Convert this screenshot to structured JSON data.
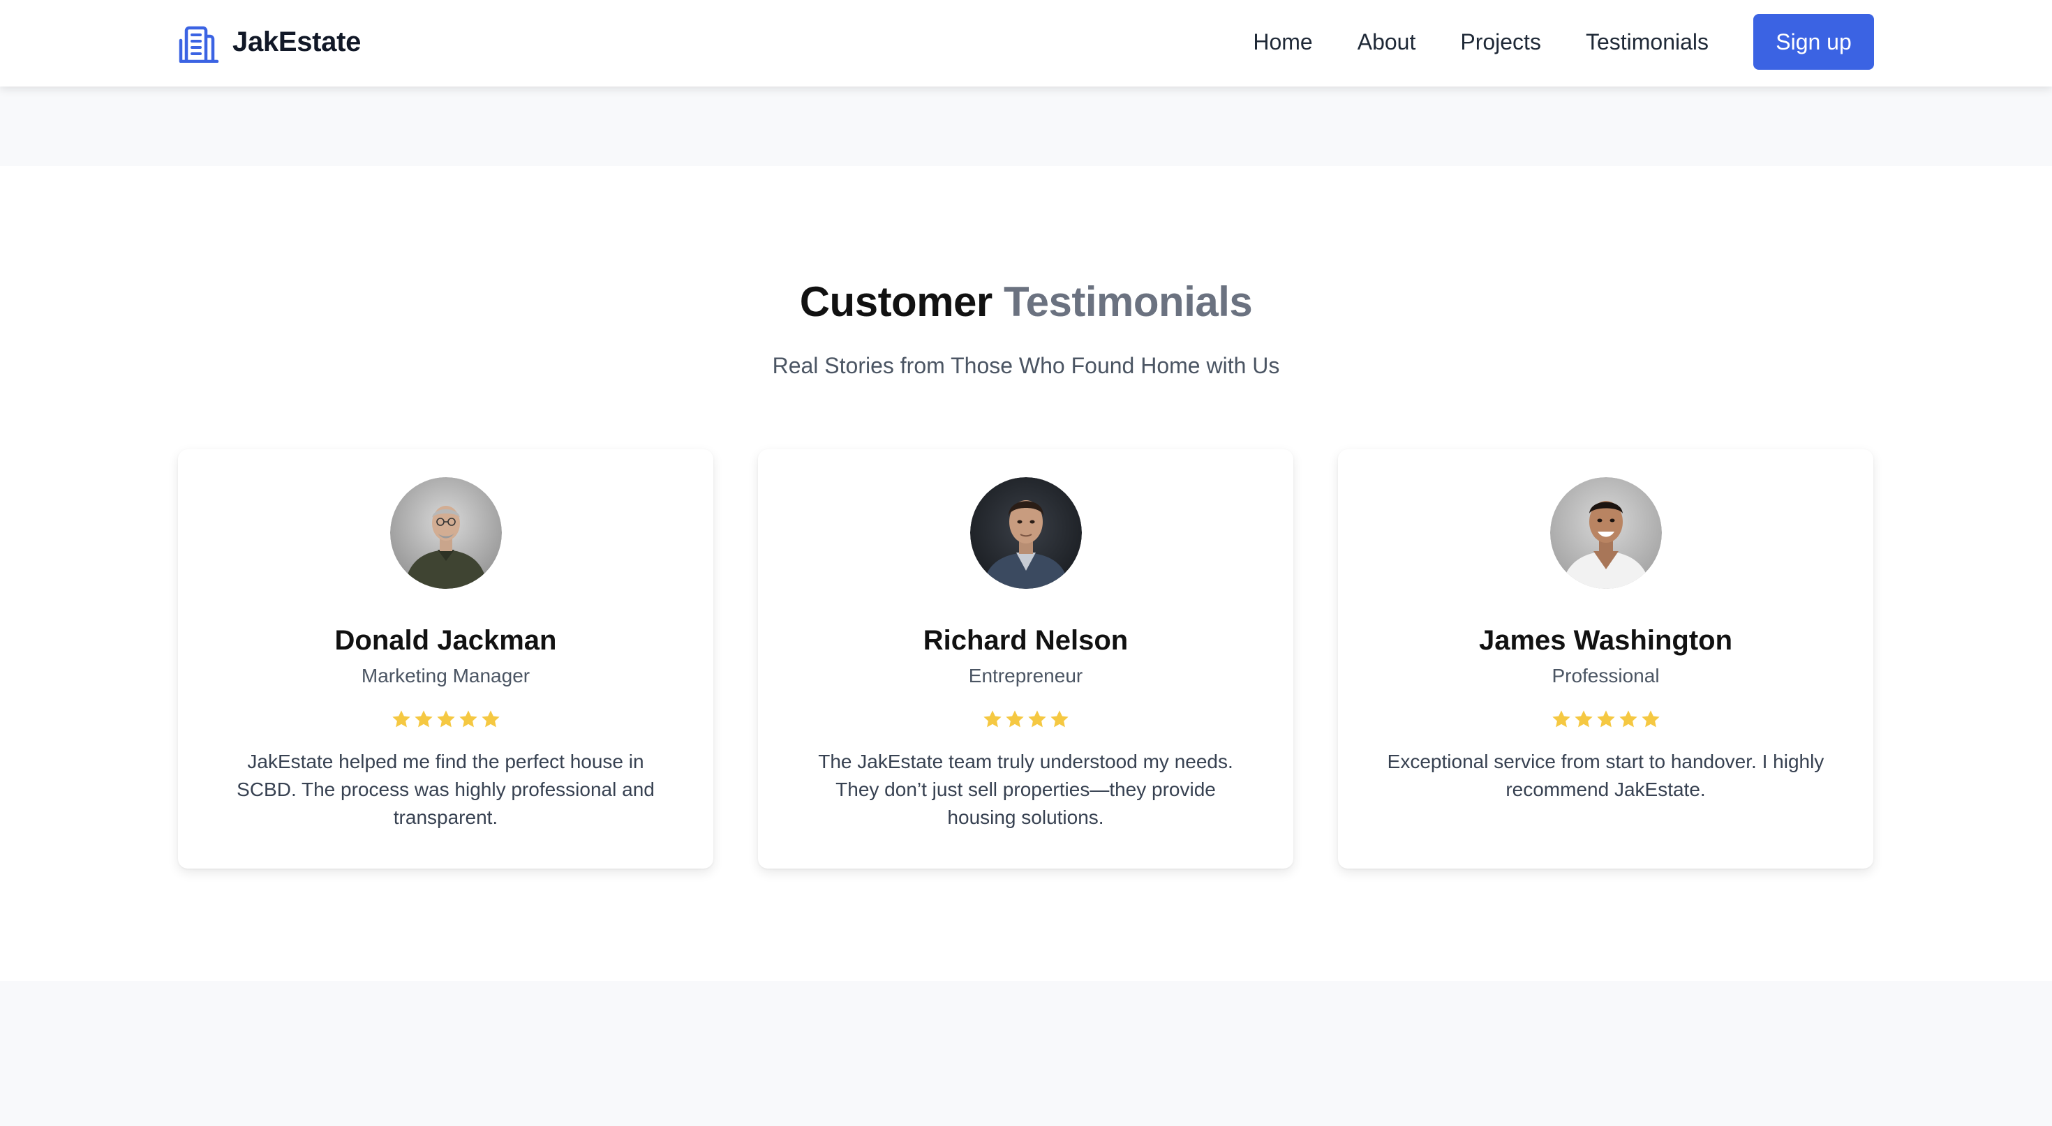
{
  "brand": {
    "name": "JakEstate",
    "icon": "building-icon",
    "color": "#3b63e3"
  },
  "nav": {
    "links": [
      "Home",
      "About",
      "Projects",
      "Testimonials"
    ],
    "signup_label": "Sign up"
  },
  "testimonials": {
    "title_main": "Customer",
    "title_accent": "Testimonials",
    "subtitle": "Real Stories from Those Who Found Home with Us",
    "star_color": "#f5c842",
    "cards": [
      {
        "name": "Donald Jackman",
        "role": "Marketing Manager",
        "rating": 5,
        "quote": "JakEstate helped me find the perfect house in SCBD. The process was highly professional and transparent."
      },
      {
        "name": "Richard Nelson",
        "role": "Entrepreneur",
        "rating": 4,
        "quote": "The JakEstate team truly understood my needs. They don’t just sell properties—they provide housing solutions."
      },
      {
        "name": "James Washington",
        "role": "Professional",
        "rating": 5,
        "quote": "Exceptional service from start to handover. I highly recommend JakEstate."
      }
    ]
  }
}
